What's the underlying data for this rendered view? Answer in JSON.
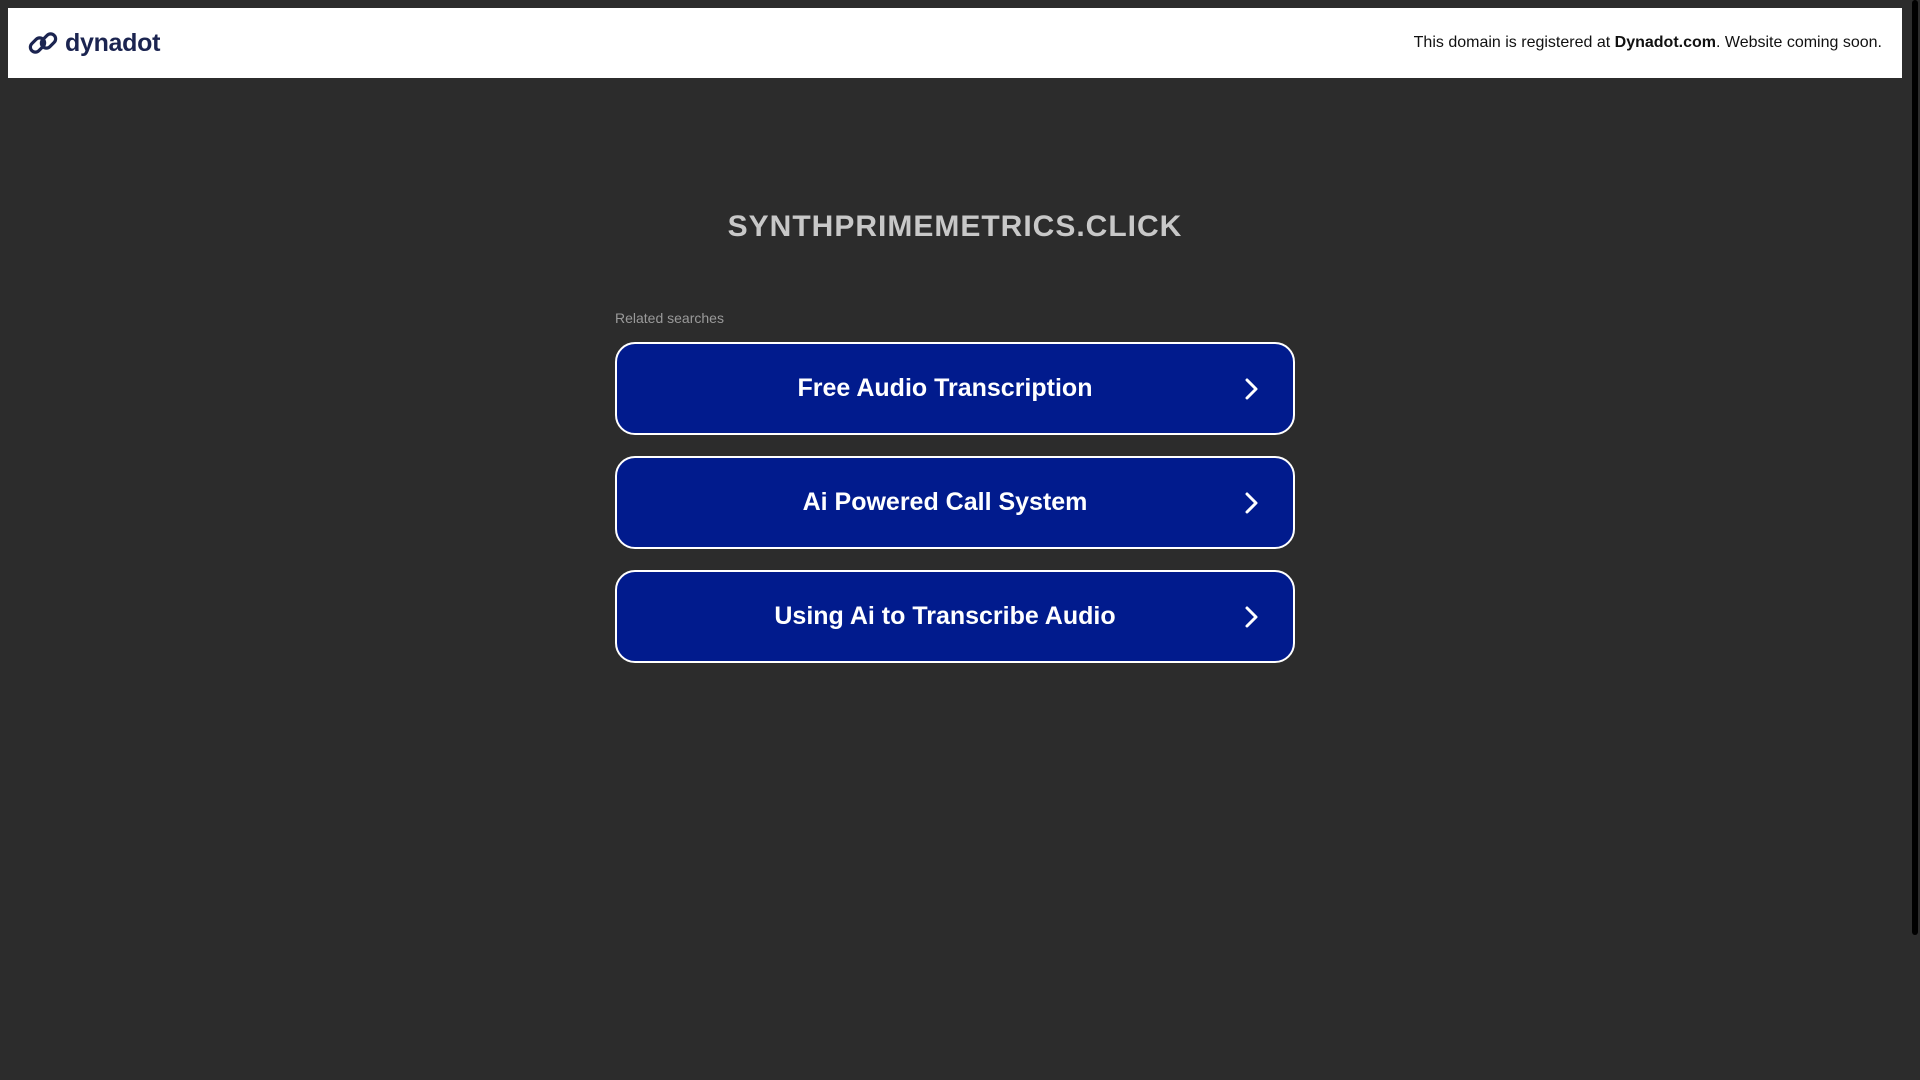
{
  "header": {
    "logo_text": "dynadot",
    "notice_prefix": "This domain is registered at ",
    "notice_brand": "Dynadot.com",
    "notice_suffix": ". Website coming soon."
  },
  "main": {
    "domain": "SYNTHPRIMEMETRICS.CLICK",
    "related_label": "Related searches",
    "results": [
      {
        "label": "Free Audio Transcription"
      },
      {
        "label": "Ai Powered Call System"
      },
      {
        "label": "Using Ai to Transcribe Audio"
      }
    ]
  },
  "colors": {
    "background": "#2c2c2c",
    "header_bg": "#ffffff",
    "button_bg": "#011b8d",
    "button_border": "#ffffff",
    "title": "#c8c8c8",
    "logo": "#1b2450"
  },
  "icons": {
    "logo": "dynadot-link-icon",
    "result_arrow": "chevron-right-icon"
  }
}
